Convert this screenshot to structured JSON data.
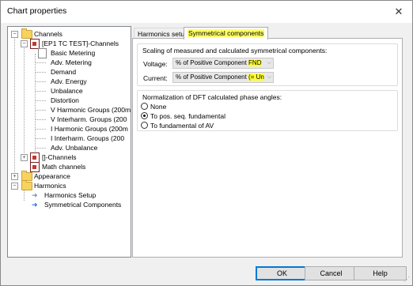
{
  "window": {
    "title": "Chart properties",
    "close_glyph": "✕"
  },
  "tree": {
    "items": [
      {
        "label": "Channels",
        "icon": "folder-icon",
        "expander": "−"
      },
      {
        "label": "[EP1 TC TEST]-Channels",
        "icon": "channel-icon",
        "expander": "−"
      },
      {
        "label": "Basic Metering",
        "icon": "checked-page-icon"
      },
      {
        "label": "Adv. Metering",
        "icon": "tree-leaf"
      },
      {
        "label": "Demand",
        "icon": "tree-leaf"
      },
      {
        "label": "Adv. Energy",
        "icon": "tree-leaf"
      },
      {
        "label": "Unbalance",
        "icon": "tree-leaf"
      },
      {
        "label": "Distortion",
        "icon": "tree-leaf"
      },
      {
        "label": "V Harmonic Groups (200m",
        "icon": "tree-leaf"
      },
      {
        "label": "V Interharm. Groups (200",
        "icon": "tree-leaf"
      },
      {
        "label": "I Harmonic Groups (200m",
        "icon": "tree-leaf"
      },
      {
        "label": "I Interharm. Groups (200",
        "icon": "tree-leaf"
      },
      {
        "label": "Adv. Unbalance",
        "icon": "tree-leaf"
      },
      {
        "label": "[]-Channels",
        "icon": "channel-icon",
        "expander": "+"
      },
      {
        "label": "Math channels",
        "icon": "channel-icon"
      },
      {
        "label": "Appearance",
        "icon": "folder-icon",
        "expander": "+"
      },
      {
        "label": "Harmonics",
        "icon": "folder-icon",
        "expander": "−"
      },
      {
        "label": "Harmonics Setup",
        "icon": "arrow-icon"
      },
      {
        "label": "Symmetrical Components",
        "icon": "arrow-icon"
      }
    ]
  },
  "tabs": [
    {
      "label": "Harmonics setup",
      "active": false
    },
    {
      "label": "Symmetrical components",
      "active": true
    }
  ],
  "scaling": {
    "title": "Scaling of measured and calculated symmetrical components:",
    "voltage_label": "Voltage:",
    "voltage_value_main": "% of Positive Component ",
    "voltage_value_hl": "FND",
    "current_label": "Current:",
    "current_value_main": "% of Positive Component ",
    "current_value_hl": "(= Un"
  },
  "normalization": {
    "title": "Normalization of DFT calculated phase angles:",
    "options": [
      {
        "label": "None",
        "checked": false
      },
      {
        "label": "To pos. seq. fundamental",
        "checked": true
      },
      {
        "label": "To fundamental of AV",
        "checked": false
      }
    ]
  },
  "buttons": {
    "ok": "OK",
    "cancel": "Cancel",
    "help": "Help"
  },
  "colors": {
    "highlight": "#ffff33",
    "accent": "#0078d7"
  }
}
